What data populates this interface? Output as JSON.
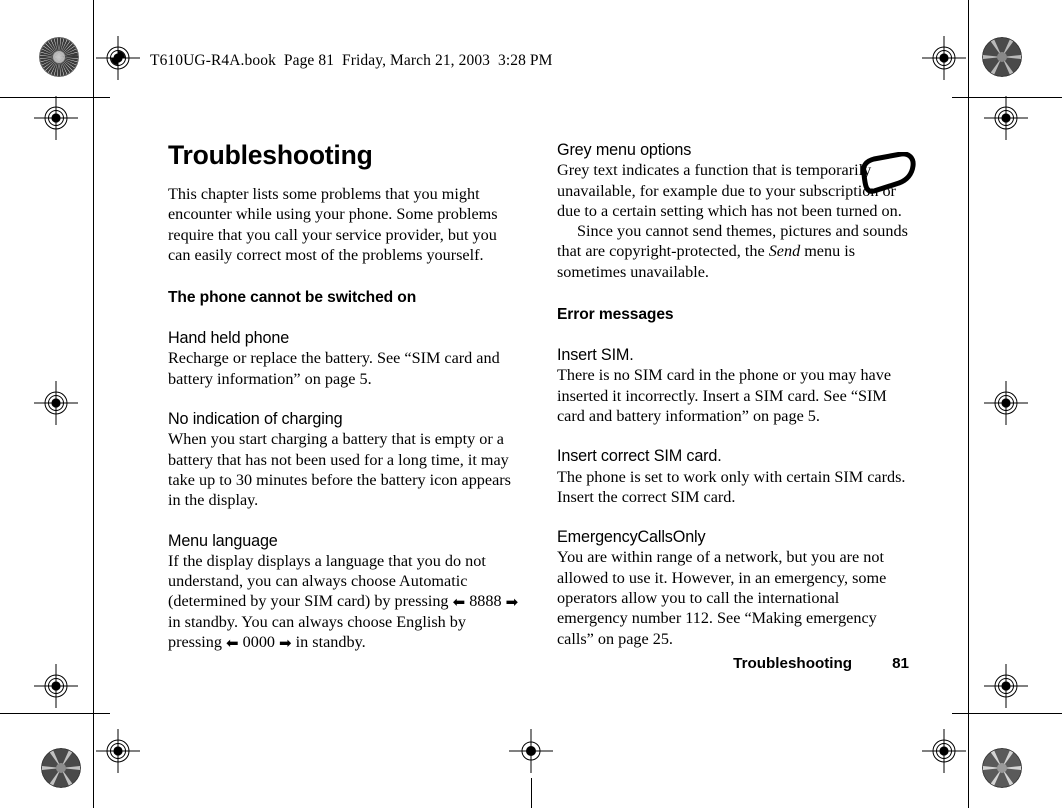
{
  "header": {
    "book_line": "T610UG-R4A.book  Page 81  Friday, March 21, 2003  3:28 PM"
  },
  "icons": {
    "registration": "registration-target-icon",
    "starburst": "starburst-resolution-target-icon",
    "key": "rounded-key-outline-icon"
  },
  "left_column": {
    "title": "Troubleshooting",
    "intro": "This chapter lists some problems that you might encounter while using your phone. Some problems require that you call your service provider, but you can easily correct most of the problems yourself.",
    "section_heading": "The phone cannot be switched on",
    "subsections": [
      {
        "heading": "Hand held phone",
        "body": "Recharge or replace the battery. See “SIM card and battery information” on page 5."
      },
      {
        "heading": "No indication of charging",
        "body": "When you start charging a battery that is empty or a battery that has not been used for a long time, it may take up to 30 minutes before the battery icon appears in the display."
      },
      {
        "heading": "Menu language",
        "body_part1": "If the display displays a language that you do not understand, you can always choose Automatic (determined by your SIM card) by pressing",
        "key_left": "⬅",
        "code_automatic": "8888",
        "key_right": "➡",
        "body_part2": "in standby. You can always choose English by pressing",
        "code_english": "0000",
        "body_part3": "in standby."
      }
    ]
  },
  "right_column": {
    "subsections_top": [
      {
        "heading": "Grey menu options",
        "body": "Grey text indicates a function that is temporarily unavailable, for example due to your subscription or due to a certain setting which has not been turned on.",
        "body_indented_pre": "Since you cannot send themes, pictures and sounds that are copyright-protected, the ",
        "body_indented_italic": "Send",
        "body_indented_post": " menu is sometimes unavailable."
      }
    ],
    "section_heading": "Error messages",
    "subsections": [
      {
        "heading": "Insert SIM.",
        "body": "There is no SIM card in the phone or you may have inserted it incorrectly. Insert a SIM card. See “SIM card and battery information” on page 5."
      },
      {
        "heading": "Insert correct SIM card.",
        "body": "The phone is set to work only with certain SIM cards. Insert the correct SIM card."
      },
      {
        "heading": "EmergencyCallsOnly",
        "body": "You are within range of a network, but you are not allowed to use it. However, in an emergency, some operators allow you to call the international emergency number 112. See “Making emergency calls” on page 25."
      }
    ]
  },
  "footer": {
    "chapter": "Troubleshooting",
    "page_number": "81"
  }
}
